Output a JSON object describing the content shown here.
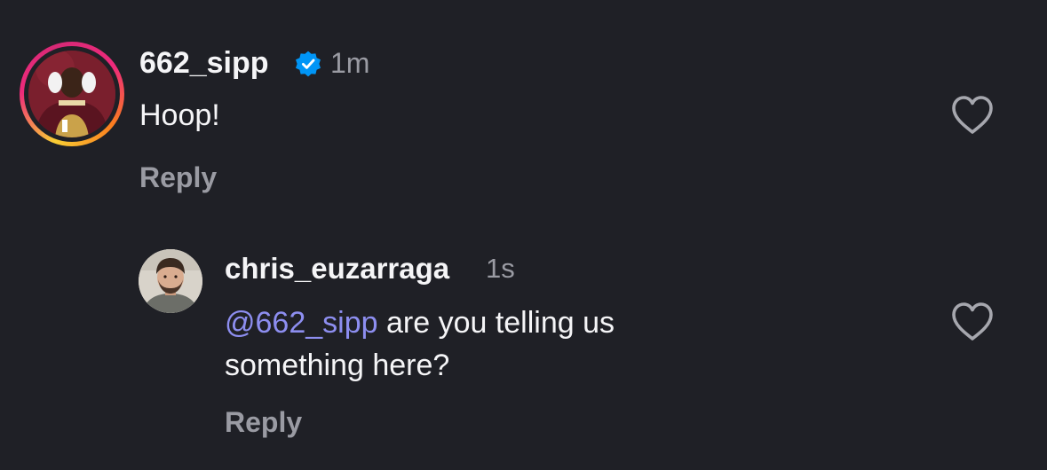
{
  "comments": [
    {
      "username": "662_sipp",
      "verified": true,
      "time": "1m",
      "text": "Hoop!",
      "reply_label": "Reply",
      "avatar_icon": "profile-photo-football-player",
      "story_ring": true,
      "like_icon": "heart-outline-icon"
    },
    {
      "username": "chris_euzarraga",
      "verified": false,
      "time": "1s",
      "mention": "@662_sipp",
      "text_line1": " are you telling us",
      "text_line2": "something here?",
      "reply_label": "Reply",
      "avatar_icon": "profile-photo-man",
      "like_icon": "heart-outline-icon"
    }
  ],
  "colors": {
    "background": "#1f2026",
    "primary_text": "#f5f5f7",
    "secondary_text": "#9a9ba3",
    "mention": "#8d8ef0",
    "verified_badge": "#0095f6"
  }
}
